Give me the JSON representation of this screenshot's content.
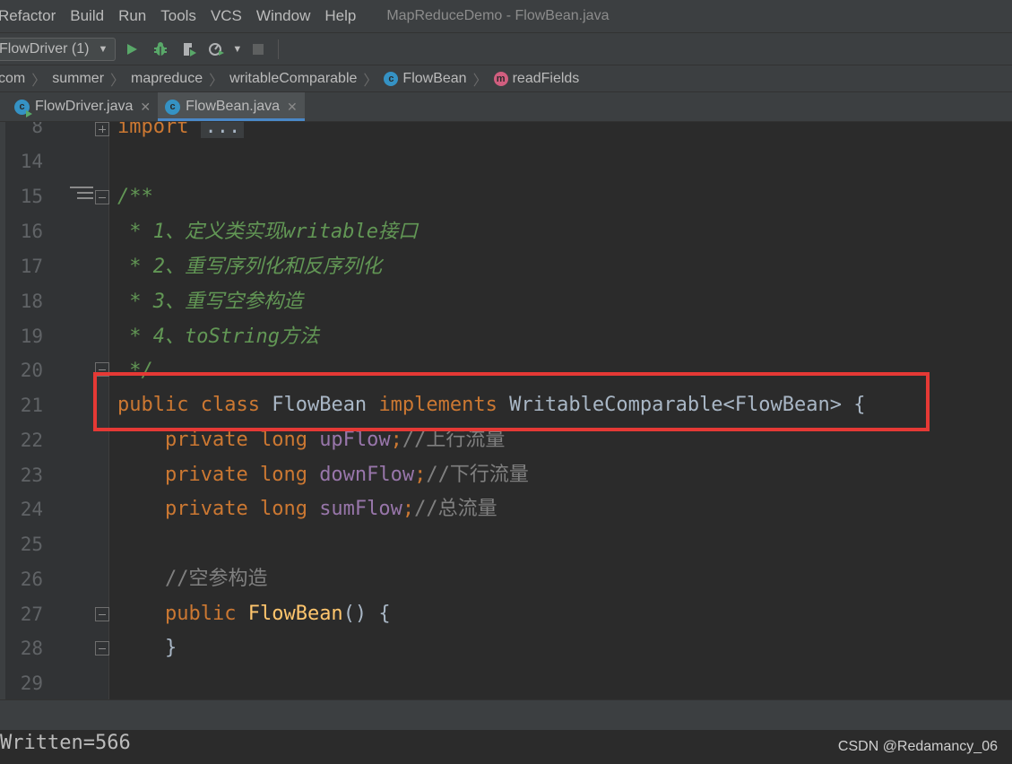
{
  "menu": {
    "items": [
      "Refactor",
      "Build",
      "Run",
      "Tools",
      "VCS",
      "Window",
      "Help"
    ],
    "window_title": "MapReduceDemo - FlowBean.java"
  },
  "toolbar": {
    "run_config": "FlowDriver (1)",
    "icons": [
      "run-icon",
      "debug-icon",
      "coverage-icon",
      "profile-icon",
      "stop-icon"
    ]
  },
  "breadcrumb": {
    "items": [
      "com",
      "summer",
      "mapreduce",
      "writableComparable",
      "FlowBean",
      "readFields"
    ],
    "class_badge": "c",
    "method_badge": "m"
  },
  "tabs": [
    {
      "label": "FlowDriver.java",
      "active": false
    },
    {
      "label": "FlowBean.java",
      "active": true
    }
  ],
  "editor": {
    "line_numbers": [
      "8",
      "14",
      "15",
      "16",
      "17",
      "18",
      "19",
      "20",
      "21",
      "22",
      "23",
      "24",
      "25",
      "26",
      "27",
      "28",
      "29"
    ],
    "lines": {
      "l8": {
        "kw": "import",
        "fold": "..."
      },
      "l15": "/**",
      "l16": " * 1、定义类实现writable接口",
      "l17": " * 2、重写序列化和反序列化",
      "l18": " * 3、重写空参构造",
      "l19": " * 4、toString方法",
      "l20": " */",
      "l21": {
        "kw1": "public",
        "kw2": "class",
        "name": "FlowBean",
        "kw3": "implements",
        "iface": "WritableComparable<FlowBean> {"
      },
      "l22": {
        "kw1": "private",
        "kw2": "long",
        "field": "upFlow",
        "semi": ";",
        "comment": "//上行流量"
      },
      "l23": {
        "kw1": "private",
        "kw2": "long",
        "field": "downFlow",
        "semi": ";",
        "comment": "//下行流量"
      },
      "l24": {
        "kw1": "private",
        "kw2": "long",
        "field": "sumFlow",
        "semi": ";",
        "comment": "//总流量"
      },
      "l26": "//空参构造",
      "l27": {
        "kw": "public",
        "method": "FlowBean",
        "rest": "() {"
      },
      "l28": "}"
    }
  },
  "console": {
    "text": "Written=566"
  },
  "watermark": "CSDN @Redamancy_06",
  "colors": {
    "highlight": "#e53935",
    "keyword": "#cc7832",
    "doc_comment": "#629755",
    "field": "#9876aa",
    "method": "#ffc66d"
  }
}
